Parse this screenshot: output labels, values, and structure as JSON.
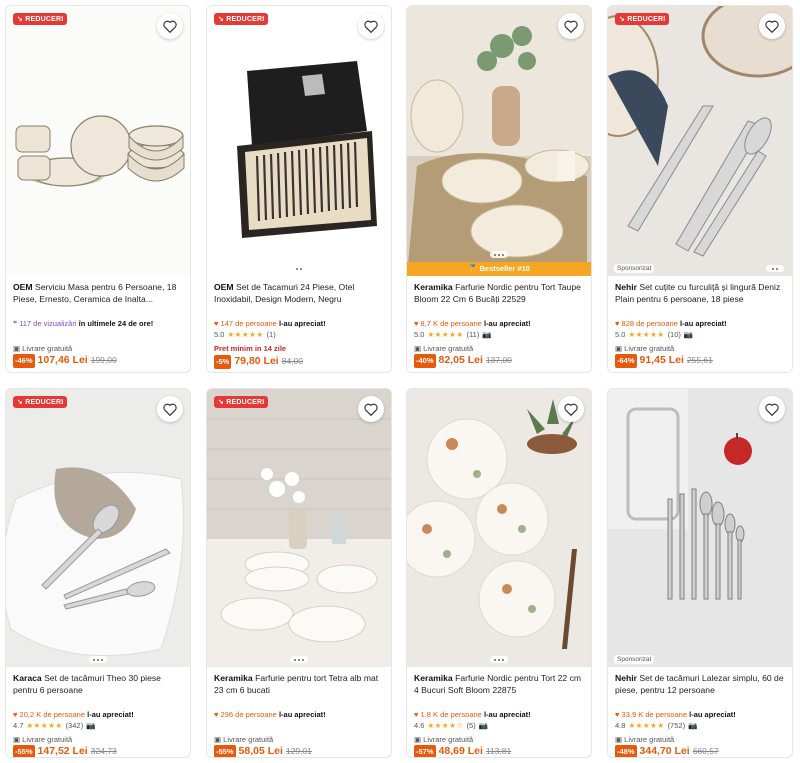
{
  "labels": {
    "reduceri": "REDUCERI",
    "livrare": "Livrare gratuită",
    "sponsorizat": "Sponsorizat",
    "apreciat": "l-au apreciat!",
    "views_suffix": "în ultimele 24 de ore!"
  },
  "products": [
    {
      "brand": "OEM",
      "title": "Serviciu Masa pentru 6 Persoane, 18 Piese, Ernesto, Ceramica de Inalta...",
      "social_count": "117 de vizualizări",
      "discount": "-46%",
      "price": "107,46 Lei",
      "old_price": "199,00"
    },
    {
      "brand": "OEM",
      "title": "Set de Tacamuri 24 Piese, Otel Inoxidabil, Design Modern, Negru",
      "social_count": "147 de persoane",
      "rating": "5.0",
      "reviews": "(1)",
      "min_price": "Pret minim in 14 zile",
      "discount": "-5%",
      "price": "79,80 Lei",
      "old_price": "84,00"
    },
    {
      "brand": "Keramika",
      "title": "Farfurie Nordic pentru Tort Taupe Bloom 22 Cm 6 Bucăți 22529",
      "social_count": "8,7 K de persoane",
      "rating": "5.0",
      "reviews": "(11)",
      "bestseller": "Bestseller #10",
      "discount": "-40%",
      "price": "82,05 Lei",
      "old_price": "137,00"
    },
    {
      "brand": "Nehir",
      "title": "Set cuțite cu furculiță și lingură Deniz Plain pentru 6 persoane, 18 piese",
      "social_count": "828 de persoane",
      "rating": "5.0",
      "reviews": "(10)",
      "discount": "-64%",
      "price": "91,45 Lei",
      "old_price": "255,61"
    },
    {
      "brand": "Karaca",
      "title": "Set de tacâmuri Theo 30 piese pentru 6 persoane",
      "social_count": "20,2 K de persoane",
      "rating": "4.7",
      "reviews": "(342)",
      "discount": "-55%",
      "price": "147,52 Lei",
      "old_price": "324,73"
    },
    {
      "brand": "Keramika",
      "title": "Farfurie pentru tort Tetra alb mat 23 cm 6 bucati",
      "social_count": "296 de persoane",
      "discount": "-55%",
      "price": "58,05 Lei",
      "old_price": "129,01"
    },
    {
      "brand": "Keramika",
      "title": "Farfurie Nordic pentru Tort 22 cm 4 Bucuri Soft Bloom 22875",
      "social_count": "1,8 K de persoane",
      "rating": "4.6",
      "reviews": "(5)",
      "discount": "-57%",
      "price": "48,69 Lei",
      "old_price": "113,81"
    },
    {
      "brand": "Nehir",
      "title": "Set de tacâmuri Lalezar simplu, 60 de piese, pentru 12 persoane",
      "social_count": "33,9 K de persoane",
      "rating": "4.8",
      "reviews": "(752)",
      "discount": "-48%",
      "price": "344,70 Lei",
      "old_price": "660,57"
    }
  ],
  "colors": {
    "accent": "#e8590c",
    "badge": "#e53935",
    "star": "#f5a623"
  }
}
